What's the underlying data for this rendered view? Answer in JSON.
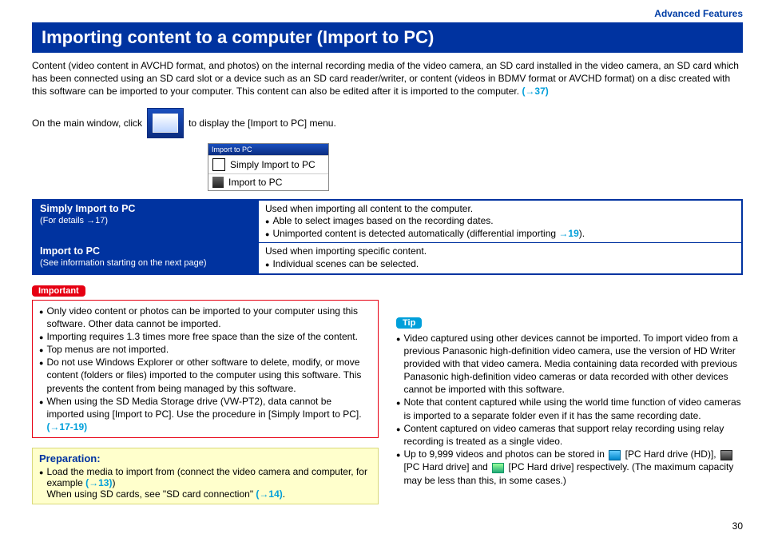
{
  "breadcrumb": "Advanced Features",
  "title": "Importing content to a computer (Import to PC)",
  "intro": {
    "text": "Content (video content in AVCHD format, and photos) on the internal recording media of the video camera, an SD card installed in the video camera, an SD card which has been connected using an SD card slot or a device such as an SD card reader/writer, or content (videos in BDMV format or AVCHD format) on a disc created with this software can be imported to your computer. This content can also be edited after it is imported to the computer. ",
    "link": "(→37)"
  },
  "clickline": {
    "before": "On the main window, click",
    "after": "to display the [Import to PC] menu."
  },
  "dropdown": {
    "header": "Import to PC",
    "item1": "Simply Import to PC",
    "item2": "Import to PC"
  },
  "table": {
    "r1_title": "Simply Import to PC",
    "r1_sub_a": "(For details ",
    "r1_sub_link": "→17",
    "r1_sub_b": ")",
    "r1_desc_line1": "Used when importing all content to the computer.",
    "r1_desc_b1": "Able to select images based on the recording dates.",
    "r1_desc_b2a": "Unimported content is detected automatically (differential importing ",
    "r1_desc_b2_link": "→19",
    "r1_desc_b2b": ").",
    "r2_title": "Import to PC",
    "r2_sub": "(See information starting on the next page)",
    "r2_desc_line1": "Used when importing specific content.",
    "r2_desc_b1": "Individual scenes can be selected."
  },
  "important": {
    "label": "Important",
    "b1": "Only video content or photos can be imported to your computer using this software. Other data cannot be imported.",
    "b2": "Importing requires 1.3 times more free space than the size of the content.",
    "b3": "Top menus are not imported.",
    "b4": "Do not use Windows Explorer or other software to delete, modify, or move content (folders or files) imported to the computer using this software. This prevents the content from being managed by this software.",
    "b5a": "When using the SD Media Storage drive (VW-PT2), data cannot be imported using [Import to PC]. Use the procedure in [Simply Import to PC]. ",
    "b5_link": "(→17-19)"
  },
  "prep": {
    "heading": "Preparation:",
    "b1a": "Load the media to import from (connect the video camera and computer, for example ",
    "b1_link": "(→13)",
    "b1b": ")",
    "line2a": "When using SD cards, see \"SD card connection\" ",
    "line2_link": "(→14)",
    "line2b": "."
  },
  "tip": {
    "label": "Tip",
    "b1": "Video captured using other devices cannot be imported. To import video from a previous Panasonic high-definition video camera, use the version of HD Writer provided with that video camera. Media containing data recorded with previous Panasonic high-definition video cameras or data recorded with other devices cannot be imported with this software.",
    "b2": "Note that content captured while using the world time function of video cameras is imported to a separate folder even if it has the same recording date.",
    "b3": "Content captured on video cameras that support relay recording using relay recording is treated as a single video.",
    "b4a": "Up to 9,999 videos and photos can be stored in ",
    "b4_lbl1": " [PC Hard drive (HD)], ",
    "b4_lbl2": " [PC Hard drive] and ",
    "b4_lbl3": " [PC Hard drive] respectively. (The maximum capacity may be less than this, in some cases.)"
  },
  "page": "30"
}
